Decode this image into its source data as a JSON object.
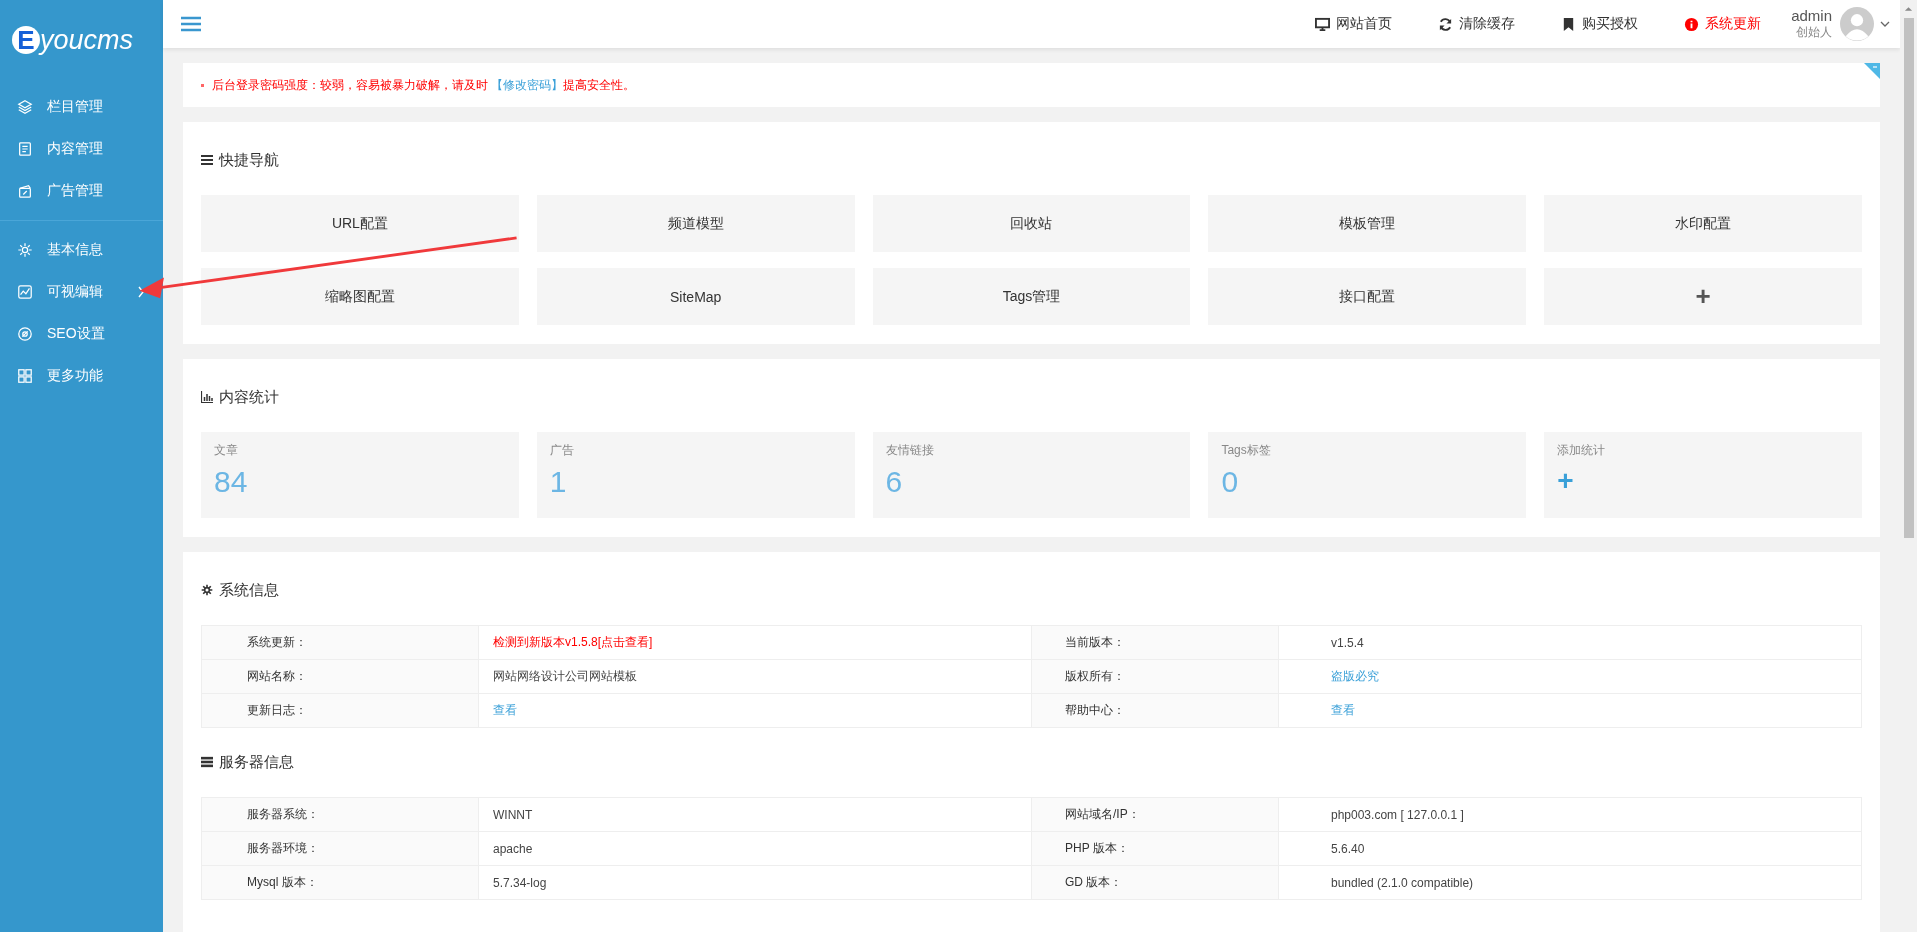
{
  "sidebar": {
    "logo": {
      "letter": "E",
      "text": "youcms"
    },
    "sections": [
      [
        {
          "label": "栏目管理",
          "has_submenu": false
        },
        {
          "label": "内容管理",
          "has_submenu": false
        },
        {
          "label": "广告管理",
          "has_submenu": false
        }
      ],
      [
        {
          "label": "基本信息",
          "has_submenu": false
        },
        {
          "label": "可视编辑",
          "has_submenu": true
        },
        {
          "label": "SEO设置",
          "has_submenu": false
        },
        {
          "label": "更多功能",
          "has_submenu": false
        }
      ]
    ]
  },
  "topbar": {
    "links": [
      {
        "label": "网站首页",
        "kind": "link"
      },
      {
        "label": "清除缓存",
        "kind": "link"
      },
      {
        "label": "购买授权",
        "kind": "link"
      },
      {
        "label": "系统更新",
        "kind": "alert"
      }
    ],
    "user": {
      "name": "admin",
      "role": "创始人"
    }
  },
  "notice": {
    "before": "后台登录密码强度：较弱，容易被暴力破解，请及时",
    "link": "【修改密码】",
    "after": "提高安全性。"
  },
  "quick_nav": {
    "title": "快捷导航",
    "tiles": [
      "URL配置",
      "频道模型",
      "回收站",
      "模板管理",
      "水印配置",
      "缩略图配置",
      "SiteMap",
      "Tags管理",
      "接口配置",
      "+"
    ]
  },
  "content_stats": {
    "title": "内容统计",
    "cards": [
      {
        "label": "文章",
        "value": "84"
      },
      {
        "label": "广告",
        "value": "1"
      },
      {
        "label": "友情链接",
        "value": "6"
      },
      {
        "label": "Tags标签",
        "value": "0"
      },
      {
        "label": "添加统计",
        "value": "+"
      }
    ]
  },
  "system_info": {
    "title": "系统信息",
    "rows": [
      [
        {
          "label": "系统更新：",
          "value": "检测到新版本v1.5.8[点击查看]",
          "kind": "alert"
        },
        {
          "label": "当前版本：",
          "value": "v1.5.4",
          "kind": "text"
        }
      ],
      [
        {
          "label": "网站名称：",
          "value": "网站网络设计公司网站模板",
          "kind": "text"
        },
        {
          "label": "版权所有：",
          "value": "盗版必究",
          "kind": "link"
        }
      ],
      [
        {
          "label": "更新日志：",
          "value": "查看",
          "kind": "link"
        },
        {
          "label": "帮助中心：",
          "value": "查看",
          "kind": "link"
        }
      ]
    ]
  },
  "server_info": {
    "title": "服务器信息",
    "rows": [
      [
        {
          "label": "服务器系统：",
          "value": "WINNT",
          "kind": "text"
        },
        {
          "label": "网站域名/IP：",
          "value": "php003.com [ 127.0.0.1 ]",
          "kind": "text"
        }
      ],
      [
        {
          "label": "服务器环境：",
          "value": "apache",
          "kind": "text"
        },
        {
          "label": "PHP 版本：",
          "value": "5.6.40",
          "kind": "text"
        }
      ],
      [
        {
          "label": "Mysql 版本：",
          "value": "5.7.34-log",
          "kind": "text"
        },
        {
          "label": "GD 版本：",
          "value": "bundled (2.1.0 compatible)",
          "kind": "text"
        }
      ]
    ]
  }
}
